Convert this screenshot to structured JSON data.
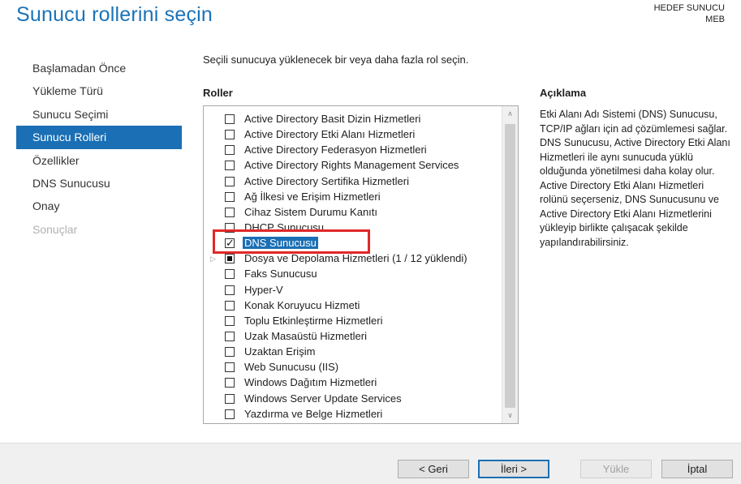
{
  "header": {
    "title": "Sunucu rollerini seçin",
    "dest_label": "HEDEF SUNUCU",
    "dest_value": "MEB"
  },
  "sidebar": {
    "items": [
      {
        "label": "Başlamadan Önce",
        "state": "normal"
      },
      {
        "label": "Yükleme Türü",
        "state": "normal"
      },
      {
        "label": "Sunucu Seçimi",
        "state": "normal"
      },
      {
        "label": "Sunucu Rolleri",
        "state": "active"
      },
      {
        "label": "Özellikler",
        "state": "normal"
      },
      {
        "label": "DNS Sunucusu",
        "state": "normal"
      },
      {
        "label": "Onay",
        "state": "normal"
      },
      {
        "label": "Sonuçlar",
        "state": "disabled"
      }
    ]
  },
  "main": {
    "instruction": "Seçili sunucuya yüklenecek bir veya daha fazla rol seçin.",
    "roles_heading": "Roller",
    "roles": [
      {
        "label": "Active Directory Basit Dizin Hizmetleri",
        "state": "unchecked"
      },
      {
        "label": "Active Directory Etki Alanı Hizmetleri",
        "state": "unchecked"
      },
      {
        "label": "Active Directory Federasyon Hizmetleri",
        "state": "unchecked"
      },
      {
        "label": "Active Directory Rights Management Services",
        "state": "unchecked"
      },
      {
        "label": "Active Directory Sertifika Hizmetleri",
        "state": "unchecked"
      },
      {
        "label": "Ağ İlkesi ve Erişim Hizmetleri",
        "state": "unchecked"
      },
      {
        "label": "Cihaz Sistem Durumu Kanıtı",
        "state": "unchecked"
      },
      {
        "label": "DHCP Sunucusu",
        "state": "unchecked"
      },
      {
        "label": "DNS Sunucusu",
        "state": "checked",
        "selected": true
      },
      {
        "label": "Dosya ve Depolama Hizmetleri (1 / 12 yüklendi)",
        "state": "partial",
        "expandable": true
      },
      {
        "label": "Faks Sunucusu",
        "state": "unchecked"
      },
      {
        "label": "Hyper-V",
        "state": "unchecked"
      },
      {
        "label": "Konak Koruyucu Hizmeti",
        "state": "unchecked"
      },
      {
        "label": "Toplu Etkinleştirme Hizmetleri",
        "state": "unchecked"
      },
      {
        "label": "Uzak Masaüstü Hizmetleri",
        "state": "unchecked"
      },
      {
        "label": "Uzaktan Erişim",
        "state": "unchecked"
      },
      {
        "label": "Web Sunucusu (IIS)",
        "state": "unchecked"
      },
      {
        "label": "Windows Dağıtım Hizmetleri",
        "state": "unchecked"
      },
      {
        "label": "Windows Server Update Services",
        "state": "unchecked"
      },
      {
        "label": "Yazdırma ve Belge Hizmetleri",
        "state": "unchecked"
      }
    ]
  },
  "description": {
    "heading": "Açıklama",
    "text": "Etki Alanı Adı Sistemi (DNS) Sunucusu, TCP/IP ağları için ad çözümlemesi sağlar. DNS Sunucusu, Active Directory Etki Alanı Hizmetleri ile aynı sunucuda yüklü olduğunda yönetilmesi daha kolay olur. Active Directory Etki Alanı Hizmetleri rolünü seçerseniz, DNS Sunucusunu ve Active Directory Etki Alanı Hizmetlerini yükleyip birlikte çalışacak şekilde yapılandırabilirsiniz."
  },
  "footer": {
    "back": "< Geri",
    "next": "İleri >",
    "install": "Yükle",
    "cancel": "İptal"
  },
  "colors": {
    "accent": "#1a6fb5",
    "title": "#1a73b8",
    "highlight_box": "#e12828"
  }
}
